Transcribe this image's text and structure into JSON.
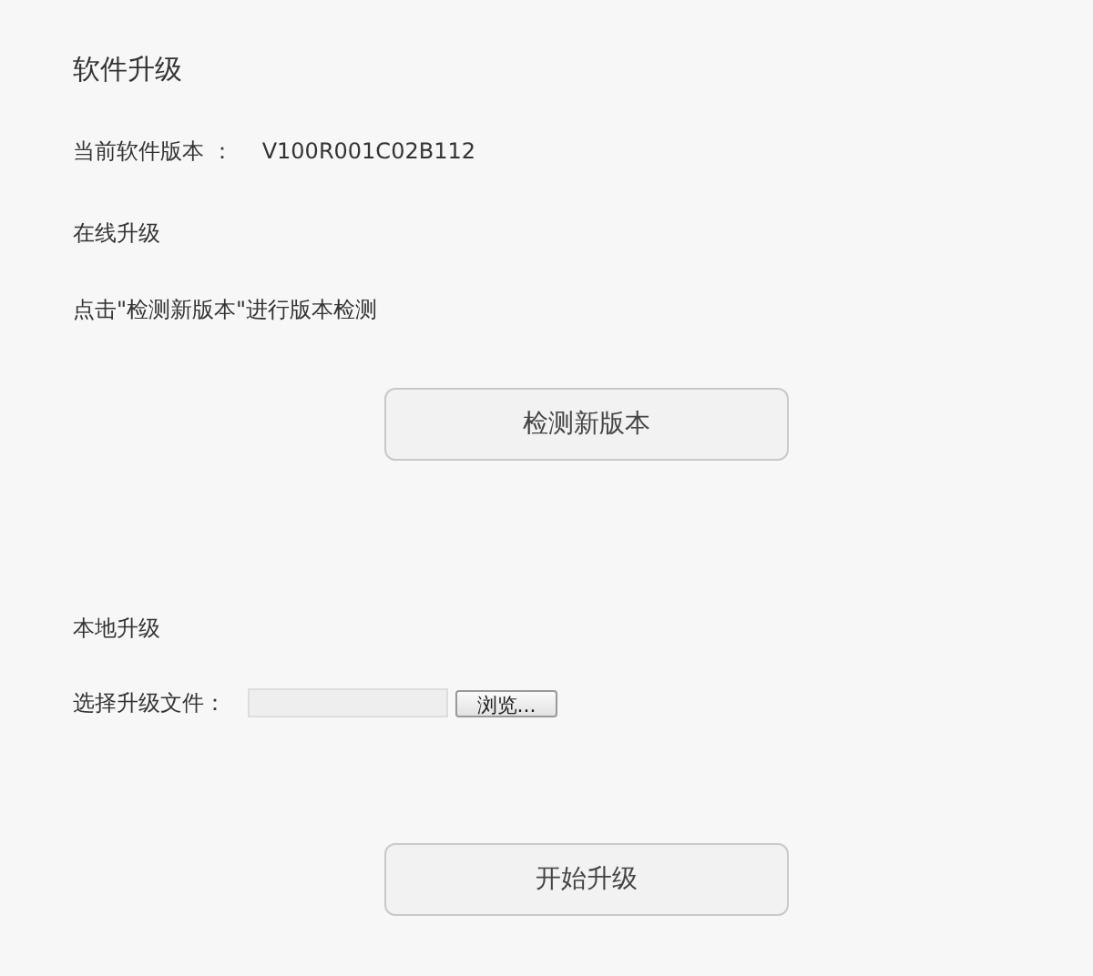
{
  "title": "软件升级",
  "current_version": {
    "label": "当前软件版本 ：",
    "value": "V100R001C02B112"
  },
  "online_upgrade": {
    "heading": "在线升级",
    "hint": "点击\"检测新版本\"进行版本检测",
    "button": "检测新版本"
  },
  "local_upgrade": {
    "heading": "本地升级",
    "file_label": "选择升级文件：",
    "browse_button": "浏览...",
    "button": "开始升级"
  }
}
